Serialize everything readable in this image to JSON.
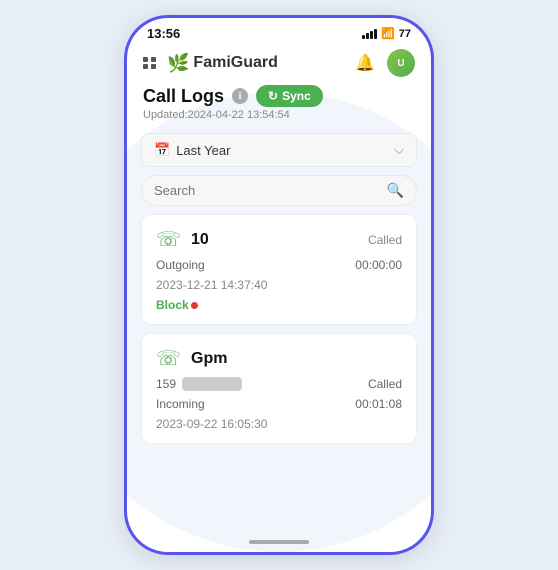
{
  "statusBar": {
    "time": "13:56"
  },
  "topNav": {
    "appName": "FamiGuard",
    "gridLabel": "menu",
    "bellLabel": "notifications",
    "avatarLabel": "user"
  },
  "pageHeader": {
    "title": "Call Logs",
    "syncLabel": "Sync",
    "updatedText": "Updated:2024-04-22 13:54:54"
  },
  "filter": {
    "label": "Last Year",
    "calendarIcon": "📅"
  },
  "search": {
    "placeholder": "Search"
  },
  "callLogs": [
    {
      "id": 1,
      "name": "10",
      "type": "outgoing",
      "status": "Called",
      "direction": "Outgoing",
      "duration": "00:00:00",
      "datetime": "2023-12-21 14:37:40",
      "blocked": true
    },
    {
      "id": 2,
      "name": "Gpm",
      "nameBlurred": true,
      "number": "159",
      "type": "incoming",
      "status": "Called",
      "direction": "Incoming",
      "duration": "00:01:08",
      "datetime": "2023-09-22 16:05:30",
      "blocked": false
    }
  ],
  "labels": {
    "block": "Block",
    "called": "Called",
    "outgoing": "Outgoing",
    "incoming": "Incoming"
  }
}
